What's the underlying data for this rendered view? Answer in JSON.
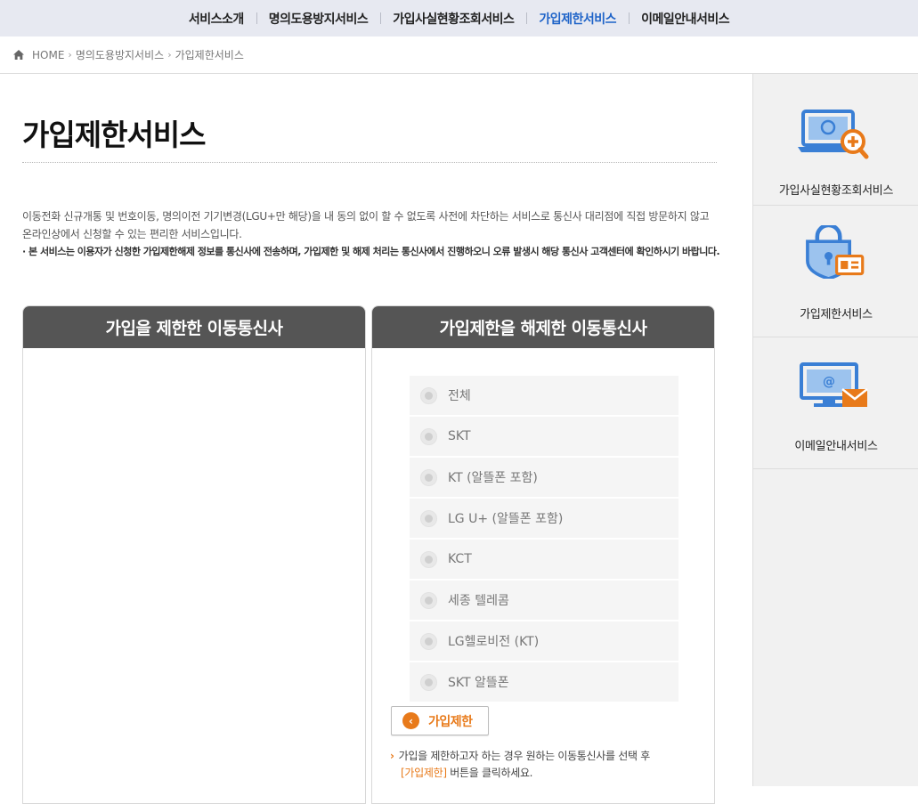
{
  "nav": {
    "items": [
      "서비스소개",
      "명의도용방지서비스",
      "가입사실현황조회서비스",
      "가입제한서비스",
      "이메일안내서비스"
    ],
    "active_index": 3,
    "active_color": "#1e63c8"
  },
  "breadcrumb": {
    "home": "HOME",
    "items": [
      "명의도용방지서비스",
      "가입제한서비스"
    ]
  },
  "page": {
    "title": "가입제한서비스",
    "description": "이동전화 신규개통 및 번호이동, 명의이전 기기변경(LGU+만 해당)을 내 동의 없이 할 수 없도록 사전에 차단하는 서비스로 통신사 대리점에 직접 방문하지 않고 온라인상에서 신청할 수 있는 편리한 서비스입니다.",
    "note": "· 본 서비스는 이용자가 신청한 가입제한해제 정보를 통신사에 전송하며, 가입제한 및 해제 처리는 통신사에서 진행하오니 오류 발생시 해당 통신사 고객센터에 확인하시기 바랍니다."
  },
  "panels": {
    "left_title": "가입을 제한한 이동통신사",
    "right_title": "가입제한을 해제한 이동통신사",
    "carriers": [
      "전체",
      "SKT",
      "KT (알뜰폰 포함)",
      "LG U+ (알뜰폰 포함)",
      "KCT",
      "세종 텔레콤",
      "LG헬로비전 (KT)",
      "SKT 알뜰폰"
    ],
    "restrict_button": "가입제한",
    "help_prefix": "가입을 제한하고자 하는 경우 원하는 이동통신사를 선택 후",
    "help_highlight": "[가입제한]",
    "help_suffix": " 버튼을 클릭하세요."
  },
  "sidebar": {
    "items": [
      "가입사실현황조회서비스",
      "가입제한서비스",
      "이메일안내서비스"
    ],
    "icons": [
      "laptop-search-icon",
      "lock-id-icon",
      "monitor-email-icon"
    ]
  },
  "colors": {
    "accent_orange": "#e87a1a",
    "icon_blue": "#3a7fd5",
    "panel_head": "#555555"
  }
}
